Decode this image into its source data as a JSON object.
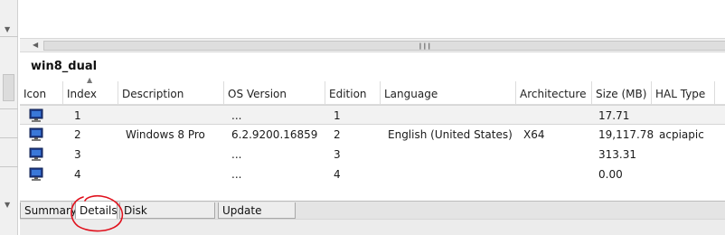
{
  "details": {
    "title": "win8_dual",
    "columns": [
      "Icon",
      "Index",
      "Description",
      "OS Version",
      "Edition",
      "Language",
      "Architecture",
      "Size (MB)",
      "HAL Type"
    ],
    "rows": [
      {
        "icon": "monitor-icon",
        "index": "1",
        "description": "",
        "os_version": "...",
        "edition": "1",
        "language": "",
        "architecture": "",
        "size_mb": "17.71",
        "hal_type": ""
      },
      {
        "icon": "monitor-icon",
        "index": "2",
        "description": "Windows 8 Pro",
        "os_version": "6.2.9200.16859",
        "edition": "2",
        "language": "English (United States)",
        "architecture": "X64",
        "size_mb": "19,117.78",
        "hal_type": "acpiapic"
      },
      {
        "icon": "monitor-icon",
        "index": "3",
        "description": "",
        "os_version": "...",
        "edition": "3",
        "language": "",
        "architecture": "",
        "size_mb": "313.31",
        "hal_type": ""
      },
      {
        "icon": "monitor-icon",
        "index": "4",
        "description": "",
        "os_version": "...",
        "edition": "4",
        "language": "",
        "architecture": "",
        "size_mb": "0.00",
        "hal_type": ""
      }
    ],
    "selected_row_index": 0
  },
  "tabs": [
    {
      "label": "Summary",
      "active": false
    },
    {
      "label": "Details",
      "active": true
    },
    {
      "label": "Disk Configuration",
      "active": false
    },
    {
      "label": "Update Status",
      "active": false
    }
  ],
  "colors": {
    "annotation_circle": "#e0101c",
    "selected_row": "#f2f2f2",
    "grid_line": "#dcdcdc"
  }
}
